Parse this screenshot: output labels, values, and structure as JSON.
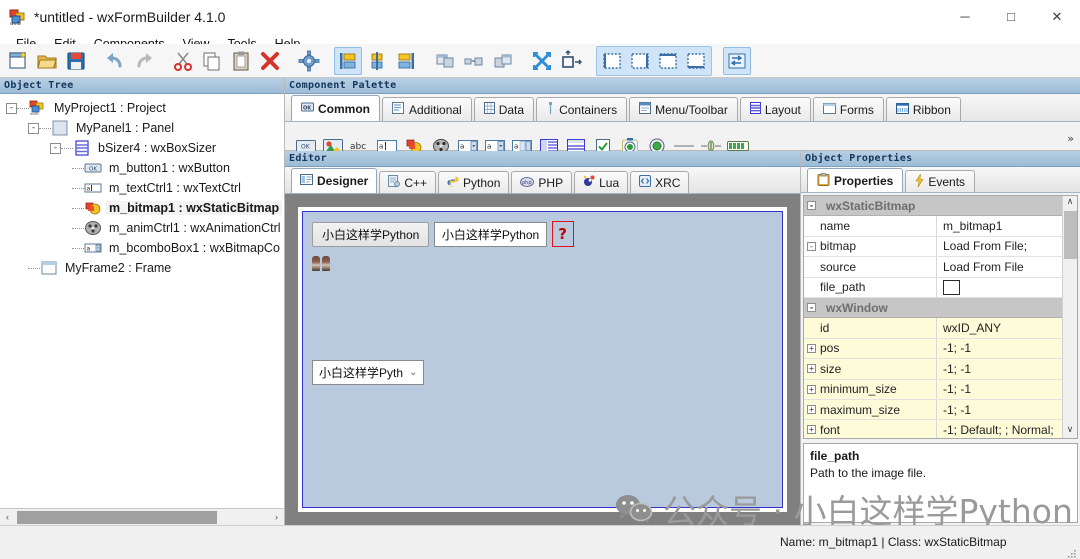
{
  "window": {
    "title": "*untitled - wxFormBuilder 4.1.0",
    "app_icon": "wxformbuilder-icon",
    "minimize": "─",
    "maximize": "□",
    "close": "✕"
  },
  "menubar": {
    "items": [
      {
        "label": "File"
      },
      {
        "label": "Edit"
      },
      {
        "label": "Components"
      },
      {
        "label": "View"
      },
      {
        "label": "Tools"
      },
      {
        "label": "Help"
      }
    ]
  },
  "toolbar": {
    "buttons": [
      {
        "name": "new-project-icon",
        "title": "New Project"
      },
      {
        "name": "open-project-icon",
        "title": "Open Project"
      },
      {
        "name": "save-project-icon",
        "title": "Save Project"
      },
      {
        "name": "undo-icon",
        "title": "Undo"
      },
      {
        "name": "redo-icon",
        "title": "Redo"
      },
      {
        "name": "cut-icon",
        "title": "Cut"
      },
      {
        "name": "copy-icon",
        "title": "Copy"
      },
      {
        "name": "paste-icon",
        "title": "Paste"
      },
      {
        "name": "delete-icon",
        "title": "Delete"
      },
      {
        "name": "generate-code-icon",
        "title": "Generate Code"
      },
      {
        "name": "align-left-icon",
        "title": "Align Left"
      },
      {
        "name": "align-center-horiz-icon",
        "title": "Align Center Horizontal"
      },
      {
        "name": "align-right-icon",
        "title": "Align Right"
      },
      {
        "name": "align-top-icon",
        "title": "Align Top"
      },
      {
        "name": "align-center-vert-icon",
        "title": "Align Center Vertical"
      },
      {
        "name": "align-bottom-icon",
        "title": "Align Bottom"
      },
      {
        "name": "expand-icon",
        "title": "Expand"
      },
      {
        "name": "stretch-icon",
        "title": "Stretch"
      },
      {
        "name": "border-left-icon",
        "title": "Border Left"
      },
      {
        "name": "border-right-icon",
        "title": "Border Right"
      },
      {
        "name": "border-top-icon",
        "title": "Border Top"
      },
      {
        "name": "border-bottom-icon",
        "title": "Border Bottom"
      },
      {
        "name": "swap-orientation-icon",
        "title": "Swap Orientation"
      }
    ]
  },
  "object_tree": {
    "header": "Object Tree",
    "nodes": [
      {
        "label": "MyProject1 : Project",
        "depth": 0,
        "expander": "-",
        "icon": "project-icon",
        "selected": false
      },
      {
        "label": "MyPanel1 : Panel",
        "depth": 1,
        "expander": "-",
        "icon": "panel-icon",
        "selected": false
      },
      {
        "label": "bSizer4 : wxBoxSizer",
        "depth": 2,
        "expander": "-",
        "icon": "boxsizer-icon",
        "selected": false
      },
      {
        "label": "m_button1 : wxButton",
        "depth": 3,
        "expander": "",
        "icon": "button-icon",
        "selected": false
      },
      {
        "label": "m_textCtrl1 : wxTextCtrl",
        "depth": 3,
        "expander": "",
        "icon": "textctrl-icon",
        "selected": false
      },
      {
        "label": "m_bitmap1 : wxStaticBitmap",
        "depth": 3,
        "expander": "",
        "icon": "staticbitmap-icon",
        "selected": true
      },
      {
        "label": "m_animCtrl1 : wxAnimationCtrl",
        "depth": 3,
        "expander": "",
        "icon": "animctrl-icon",
        "selected": false
      },
      {
        "label": "m_bcomboBox1 : wxBitmapCo",
        "depth": 3,
        "expander": "",
        "icon": "bitmapcombo-icon",
        "selected": false
      },
      {
        "label": "MyFrame2 : Frame",
        "depth": 1,
        "expander": "",
        "icon": "frame-icon",
        "selected": false
      }
    ],
    "hscroll": {
      "left_arrow": "‹",
      "right_arrow": "›"
    }
  },
  "palette": {
    "header": "Component Palette",
    "tabs": [
      {
        "label": "Common",
        "icon": "common-icon",
        "active": true
      },
      {
        "label": "Additional",
        "icon": "additional-icon",
        "active": false
      },
      {
        "label": "Data",
        "icon": "data-icon",
        "active": false
      },
      {
        "label": "Containers",
        "icon": "containers-icon",
        "active": false
      },
      {
        "label": "Menu/Toolbar",
        "icon": "menutoolbar-icon",
        "active": false
      },
      {
        "label": "Layout",
        "icon": "layout-icon",
        "active": false
      },
      {
        "label": "Forms",
        "icon": "forms-icon",
        "active": false
      },
      {
        "label": "Ribbon",
        "icon": "ribbon-icon",
        "active": false
      }
    ],
    "components": [
      {
        "name": "wxbutton-icon",
        "label": "OK"
      },
      {
        "name": "wxbitmapbutton-icon",
        "label": ""
      },
      {
        "name": "wxstatictext-icon",
        "label": "abc"
      },
      {
        "name": "wxtextctrl-icon",
        "label": "a"
      },
      {
        "name": "wxstaticbitmap-icon",
        "label": ""
      },
      {
        "name": "wxanimationctrl-icon",
        "label": ""
      },
      {
        "name": "wxcombobox-icon",
        "label": "a"
      },
      {
        "name": "wxchoice-icon",
        "label": "a"
      },
      {
        "name": "wxbitmapcombobox-icon",
        "label": "a"
      },
      {
        "name": "wxlistbox-icon",
        "label": ""
      },
      {
        "name": "wxlistctrl-icon",
        "label": ""
      },
      {
        "name": "wxcheckbox-icon",
        "label": ""
      },
      {
        "name": "wxradiobutton-icon",
        "label": ""
      },
      {
        "name": "wxtogglebutton-icon",
        "label": ""
      },
      {
        "name": "wxstaticline-icon",
        "label": ""
      },
      {
        "name": "wxslider-icon",
        "label": ""
      },
      {
        "name": "wxgauge-icon",
        "label": ""
      }
    ],
    "more_chevron": "»"
  },
  "editor": {
    "header": "Editor",
    "tabs": [
      {
        "label": "Designer",
        "icon": "designer-icon",
        "active": true
      },
      {
        "label": "C++",
        "icon": "cpp-icon",
        "active": false
      },
      {
        "label": "Python",
        "icon": "python-icon",
        "active": false
      },
      {
        "label": "PHP",
        "icon": "php-icon",
        "active": false
      },
      {
        "label": "Lua",
        "icon": "lua-icon",
        "active": false
      },
      {
        "label": "XRC",
        "icon": "xrc-icon",
        "active": false
      }
    ],
    "canvas": {
      "background": "#808080",
      "form_background": "#b9cade",
      "form_border": "#3333cc",
      "widgets": [
        {
          "type": "wxButton",
          "name": "m_button1",
          "text": "小白这样学Python"
        },
        {
          "type": "wxTextCtrl",
          "name": "m_textCtrl1",
          "text": "小白这样学Python"
        },
        {
          "type": "wxStaticBitmap",
          "name": "m_bitmap1",
          "text": "?",
          "selected": true,
          "selection_color": "#e01414"
        },
        {
          "type": "wxAnimationCtrl",
          "name": "m_animCtrl1",
          "text": ""
        },
        {
          "type": "wxBitmapComboBox",
          "name": "m_bcomboBox1",
          "text": "小白这样学Pyth",
          "arrow": "⌄"
        }
      ]
    }
  },
  "object_properties": {
    "header": "Object Properties",
    "tabs": [
      {
        "label": "Properties",
        "icon": "properties-icon",
        "active": true
      },
      {
        "label": "Events",
        "icon": "events-icon",
        "active": false
      }
    ],
    "rows": [
      {
        "kind": "category",
        "expander": "-",
        "label": "wxStaticBitmap",
        "value": ""
      },
      {
        "kind": "prop",
        "expander": "",
        "label": "name",
        "value": "m_bitmap1",
        "indent": 0,
        "highlight": false
      },
      {
        "kind": "prop",
        "expander": "-",
        "label": "bitmap",
        "value": "Load From File;",
        "indent": 0,
        "highlight": false
      },
      {
        "kind": "prop",
        "expander": "",
        "label": "source",
        "value": "Load From File",
        "indent": 1,
        "highlight": false
      },
      {
        "kind": "prop",
        "expander": "",
        "label": "file_path",
        "value": "",
        "indent": 1,
        "highlight": false,
        "editor": "textbox"
      },
      {
        "kind": "category",
        "expander": "-",
        "label": "wxWindow",
        "value": ""
      },
      {
        "kind": "prop",
        "expander": "",
        "label": "id",
        "value": "wxID_ANY",
        "indent": 0,
        "highlight": true
      },
      {
        "kind": "prop",
        "expander": "+",
        "label": "pos",
        "value": "-1; -1",
        "indent": 0,
        "highlight": true
      },
      {
        "kind": "prop",
        "expander": "+",
        "label": "size",
        "value": "-1; -1",
        "indent": 0,
        "highlight": true
      },
      {
        "kind": "prop",
        "expander": "+",
        "label": "minimum_size",
        "value": "-1; -1",
        "indent": 0,
        "highlight": true
      },
      {
        "kind": "prop",
        "expander": "+",
        "label": "maximum_size",
        "value": "-1; -1",
        "indent": 0,
        "highlight": true
      },
      {
        "kind": "prop",
        "expander": "+",
        "label": "font",
        "value": "-1; Default; ; Normal;",
        "indent": 0,
        "highlight": true
      }
    ],
    "scroll": {
      "up": "∧",
      "down": "∨"
    },
    "description": {
      "title": "file_path",
      "body": "Path to the image file."
    }
  },
  "status_bar": {
    "text": "Name: m_bitmap1 | Class: wxStaticBitmap"
  },
  "watermark": {
    "icon": "wechat-icon",
    "text": "公众号 · 小白这样学Python"
  },
  "colors": {
    "panel_header_from": "#b7cfe3",
    "panel_header_to": "#9dbcd6",
    "canvas_gray": "#808080",
    "form_blue": "#b9cade",
    "highlight_yellow": "#fdfbd8",
    "category_gray": "#c6c6c6",
    "tab_active": "#ffffff",
    "accent_blue": "#cfe4f7"
  }
}
